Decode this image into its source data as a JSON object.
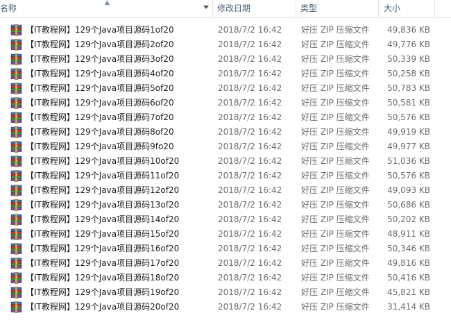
{
  "columns": {
    "name": "名称",
    "date": "修改日期",
    "type": "类型",
    "size": "大小"
  },
  "colors": {
    "header_text": "#4c607a",
    "secondary_text": "#6d6d6d",
    "icon_stack": [
      "#2f6fd6",
      "#d12d2d",
      "#2f9e3f",
      "#7a45b8"
    ]
  },
  "file_icon": "winrar-archive-icon",
  "files": [
    {
      "name": "【IT教程网】129个Java项目源码1of20",
      "date": "2018/7/2 16:42",
      "type": "好压 ZIP 压缩文件",
      "size": "49,836 KB"
    },
    {
      "name": "【IT教程网】129个Java项目源码2of20",
      "date": "2018/7/2 16:42",
      "type": "好压 ZIP 压缩文件",
      "size": "49,776 KB"
    },
    {
      "name": "【IT教程网】129个Java项目源码3of20",
      "date": "2018/7/2 16:42",
      "type": "好压 ZIP 压缩文件",
      "size": "50,339 KB"
    },
    {
      "name": "【IT教程网】129个Java项目源码4of20",
      "date": "2018/7/2 16:42",
      "type": "好压 ZIP 压缩文件",
      "size": "50,258 KB"
    },
    {
      "name": "【IT教程网】129个Java项目源码5of20",
      "date": "2018/7/2 16:42",
      "type": "好压 ZIP 压缩文件",
      "size": "50,783 KB"
    },
    {
      "name": "【IT教程网】129个Java项目源码6of20",
      "date": "2018/7/2 16:42",
      "type": "好压 ZIP 压缩文件",
      "size": "50,581 KB"
    },
    {
      "name": "【IT教程网】129个Java项目源码7of20",
      "date": "2018/7/2 16:42",
      "type": "好压 ZIP 压缩文件",
      "size": "50,576 KB"
    },
    {
      "name": "【IT教程网】129个Java项目源码8of20",
      "date": "2018/7/2 16:42",
      "type": "好压 ZIP 压缩文件",
      "size": "49,919 KB"
    },
    {
      "name": "【IT教程网】129个Java项目源码9fo20",
      "date": "2018/7/2 16:42",
      "type": "好压 ZIP 压缩文件",
      "size": "49,977 KB"
    },
    {
      "name": "【IT教程网】129个Java项目源码10of20",
      "date": "2018/7/2 16:42",
      "type": "好压 ZIP 压缩文件",
      "size": "51,036 KB"
    },
    {
      "name": "【IT教程网】129个Java项目源码11of20",
      "date": "2018/7/2 16:42",
      "type": "好压 ZIP 压缩文件",
      "size": "50,576 KB"
    },
    {
      "name": "【IT教程网】129个Java项目源码12of20",
      "date": "2018/7/2 16:42",
      "type": "好压 ZIP 压缩文件",
      "size": "49,093 KB"
    },
    {
      "name": "【IT教程网】129个Java项目源码13of20",
      "date": "2018/7/2 16:42",
      "type": "好压 ZIP 压缩文件",
      "size": "50,686 KB"
    },
    {
      "name": "【IT教程网】129个Java项目源码14of20",
      "date": "2018/7/2 16:42",
      "type": "好压 ZIP 压缩文件",
      "size": "50,202 KB"
    },
    {
      "name": "【IT教程网】129个Java项目源码15of20",
      "date": "2018/7/2 16:42",
      "type": "好压 ZIP 压缩文件",
      "size": "48,911 KB"
    },
    {
      "name": "【IT教程网】129个Java项目源码16of20",
      "date": "2018/7/2 16:42",
      "type": "好压 ZIP 压缩文件",
      "size": "50,346 KB"
    },
    {
      "name": "【IT教程网】129个Java项目源码17of20",
      "date": "2018/7/2 16:42",
      "type": "好压 ZIP 压缩文件",
      "size": "49,816 KB"
    },
    {
      "name": "【IT教程网】129个Java项目源码18of20",
      "date": "2018/7/2 16:42",
      "type": "好压 ZIP 压缩文件",
      "size": "50,416 KB"
    },
    {
      "name": "【IT教程网】129个Java项目源码19of20",
      "date": "2018/7/2 16:42",
      "type": "好压 ZIP 压缩文件",
      "size": "45,821 KB"
    },
    {
      "name": "【IT教程网】129个Java项目源码20of20",
      "date": "2018/7/2 16:42",
      "type": "好压 ZIP 压缩文件",
      "size": "31,414 KB"
    }
  ]
}
